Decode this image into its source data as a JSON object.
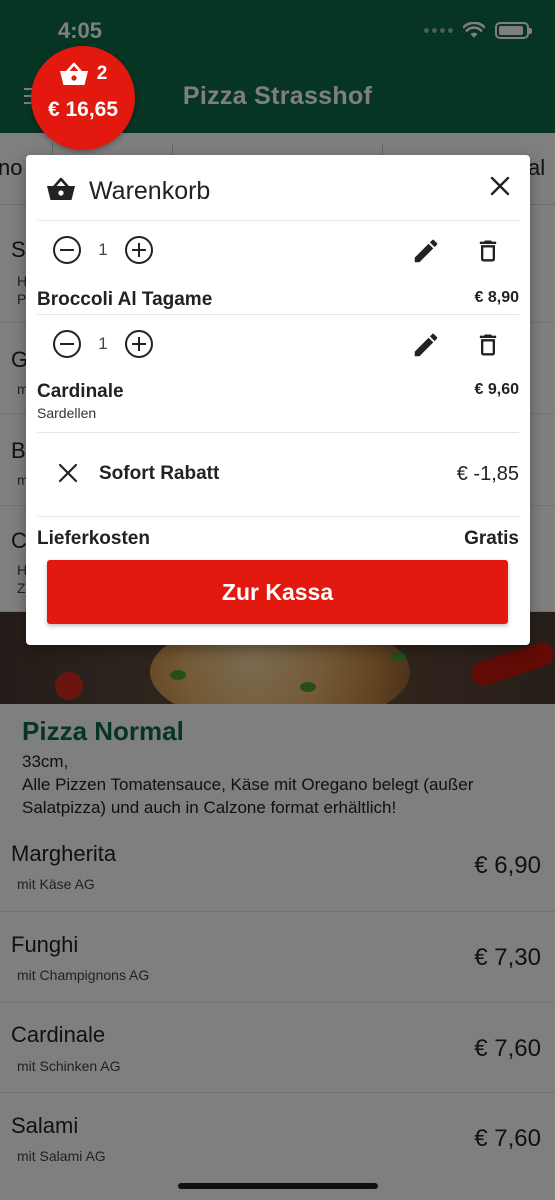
{
  "status_bar": {
    "time": "4:05"
  },
  "app": {
    "title": "Pizza Strasshof"
  },
  "tabs": [
    {
      "label": "no"
    },
    {
      "label": "al"
    }
  ],
  "background_list_top": [
    {
      "name": "S",
      "desc_lines": [
        "H",
        "P"
      ]
    },
    {
      "name": "G",
      "desc_lines": [
        "m"
      ]
    },
    {
      "name": "B",
      "desc_lines": [
        "m"
      ]
    },
    {
      "name": "C",
      "desc_lines": [
        "H",
        "Z"
      ]
    }
  ],
  "section": {
    "title": "Pizza Normal",
    "desc_line1": "33cm,",
    "desc_line2": "Alle Pizzen Tomatensauce, Käse mit Oregano belegt (außer",
    "desc_line3": "Salatpizza) und auch in Calzone format erhältlich!"
  },
  "menu_items": [
    {
      "name": "Margherita",
      "desc": "mit Käse AG",
      "price": "€ 6,90"
    },
    {
      "name": "Funghi",
      "desc": "mit Champignons AG",
      "price": "€ 7,30"
    },
    {
      "name": "Cardinale",
      "desc": "mit Schinken AG",
      "price": "€ 7,60"
    },
    {
      "name": "Salami",
      "desc": "mit Salami AG",
      "price": "€ 7,60"
    }
  ],
  "cart_badge": {
    "count": "2",
    "total": "€ 16,65"
  },
  "cart": {
    "title": "Warenkorb",
    "items": [
      {
        "qty": "1",
        "name": "Broccoli Al Tagame",
        "price": "€ 8,90",
        "note": ""
      },
      {
        "qty": "1",
        "name": "Cardinale",
        "price": "€ 9,60",
        "note": "Sardellen"
      }
    ],
    "discount_label": "Sofort Rabatt",
    "discount_value": "€ -1,85",
    "delivery_label": "Lieferkosten",
    "delivery_value": "Gratis",
    "checkout_label": "Zur Kassa"
  },
  "colors": {
    "brand_green": "#0e6b47",
    "accent_red": "#e3190f"
  },
  "icons": [
    "basket-icon",
    "close-icon",
    "minus-circle-icon",
    "plus-circle-icon",
    "pencil-icon",
    "trash-icon",
    "menu-icon",
    "wifi-icon",
    "battery-icon"
  ]
}
